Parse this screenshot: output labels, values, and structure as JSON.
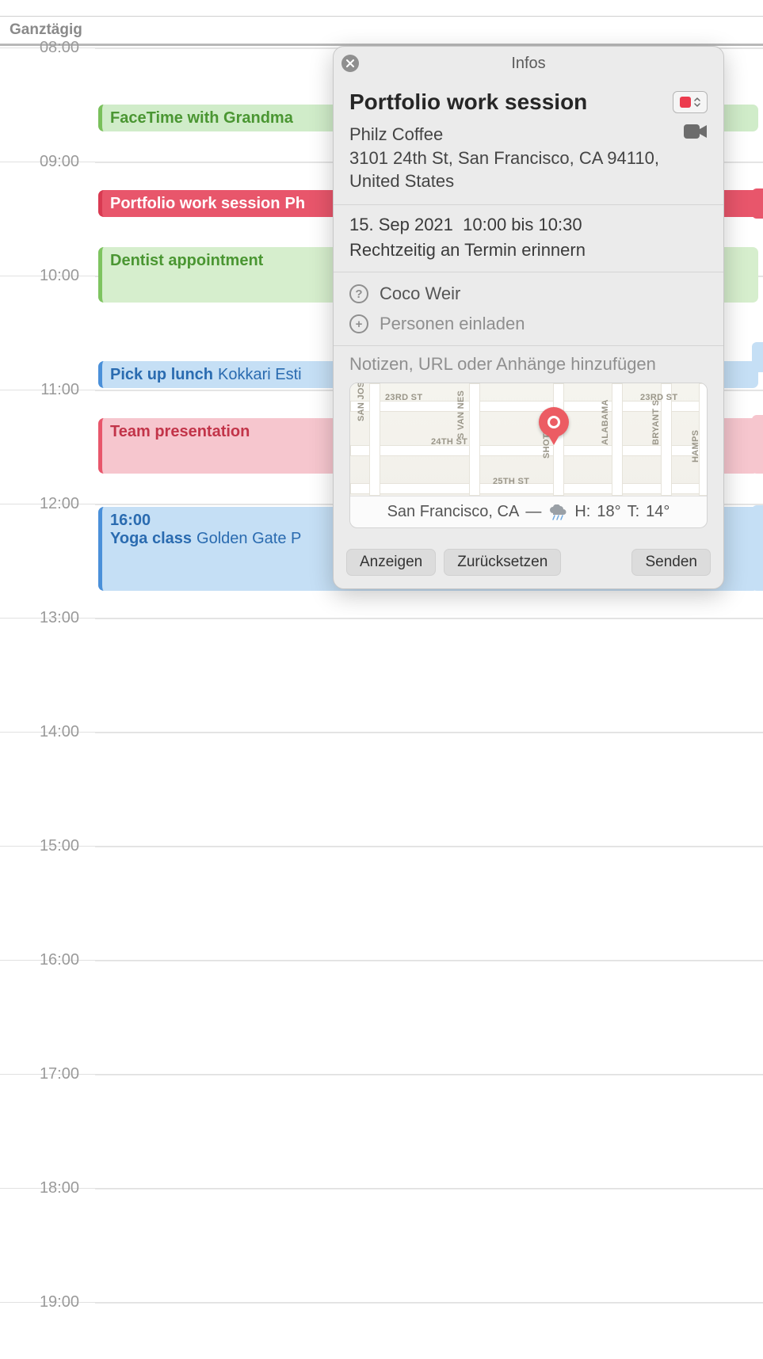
{
  "allday_label": "Ganztägig",
  "hours": [
    "08:00",
    "09:00",
    "10:00",
    "11:00",
    "12:00",
    "13:00",
    "14:00",
    "15:00",
    "16:00",
    "17:00",
    "18:00",
    "19:00"
  ],
  "events": {
    "facetime": {
      "title": "FaceTime with Grandma"
    },
    "portfolio": {
      "title": "Portfolio work session",
      "sub": "Ph"
    },
    "dentist": {
      "title": "Dentist appointment"
    },
    "lunch": {
      "title": "Pick up lunch",
      "sub": "Kokkari Esti"
    },
    "team": {
      "title": "Team presentation"
    },
    "yoga": {
      "time": "16:00",
      "title": "Yoga class",
      "sub": "Golden Gate P"
    }
  },
  "popover": {
    "header": "Infos",
    "title": "Portfolio work session",
    "calendar_color": "#ec3b4e",
    "location_name": "Philz Coffee",
    "location_address": "3101 24th St, San Francisco, CA 94110, United States",
    "date": "15. Sep 2021",
    "time_range": "10:00 bis 10:30",
    "alert_text": "Rechtzeitig an Termin erinnern",
    "attendee": "Coco Weir",
    "invite_placeholder": "Personen einladen",
    "notes_placeholder": "Notizen, URL oder Anhänge hinzufügen",
    "map": {
      "streets_h": [
        "23RD ST",
        "24TH ST",
        "25TH ST"
      ],
      "streets_v": [
        "SAN JOSE",
        "S VAN NES",
        "SHOTWEL",
        "ALABAMA",
        "BRYANT S",
        "HAMPS"
      ],
      "right_label": "23RD ST",
      "city": "San Francisco, CA",
      "separator": "—",
      "high_label": "H:",
      "high_val": "18°",
      "low_label": "T:",
      "low_val": "14°"
    },
    "buttons": {
      "show": "Anzeigen",
      "reset": "Zurücksetzen",
      "send": "Senden"
    }
  }
}
